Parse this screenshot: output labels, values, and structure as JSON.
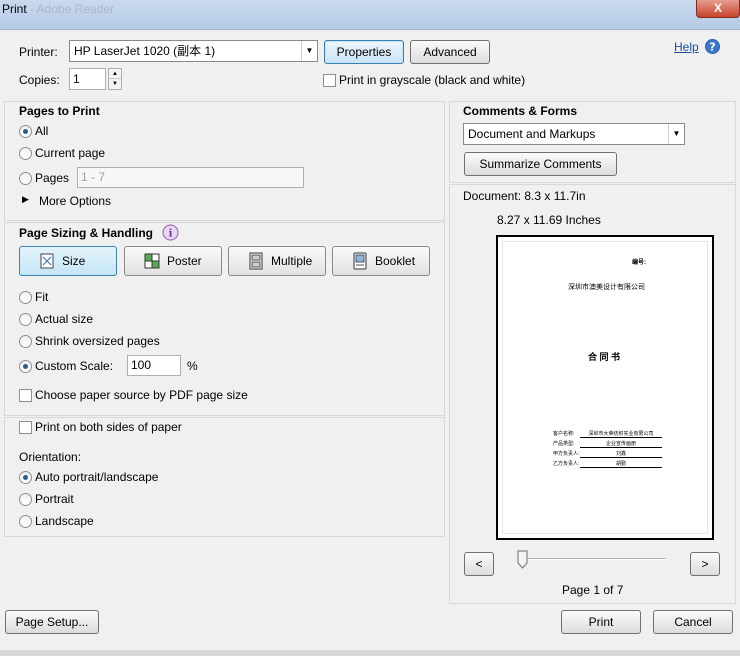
{
  "window": {
    "title": "Print",
    "ghost_title": "- Adobe Reader",
    "close_label": "X"
  },
  "printer": {
    "label": "Printer:",
    "selected": "HP LaserJet 1020 (副本 1)",
    "properties_label": "Properties",
    "advanced_label": "Advanced",
    "help_label": "Help"
  },
  "copies": {
    "label": "Copies:",
    "value": "1"
  },
  "grayscale": {
    "label": "Print in grayscale (black and white)",
    "checked": false
  },
  "pages_to_print": {
    "heading": "Pages to Print",
    "all_label": "All",
    "current_label": "Current page",
    "pages_label": "Pages",
    "pages_placeholder": "1 - 7",
    "more_options_label": "More Options",
    "selected": "All"
  },
  "sizing": {
    "heading": "Page Sizing & Handling",
    "buttons": [
      "Size",
      "Poster",
      "Multiple",
      "Booklet"
    ],
    "selected_button": "Size",
    "fit_label": "Fit",
    "actual_label": "Actual size",
    "shrink_label": "Shrink oversized pages",
    "custom_label": "Custom Scale:",
    "custom_value": "100",
    "percent": "%",
    "paper_source_label": "Choose paper source by PDF page size",
    "selected": "Custom Scale"
  },
  "duplex": {
    "label": "Print on both sides of paper",
    "checked": false
  },
  "orientation": {
    "heading": "Orientation:",
    "auto_label": "Auto portrait/landscape",
    "portrait_label": "Portrait",
    "landscape_label": "Landscape",
    "selected": "Auto portrait/landscape"
  },
  "comments": {
    "heading": "Comments & Forms",
    "selected": "Document and Markups",
    "summarize_label": "Summarize Comments"
  },
  "preview": {
    "document_size": "Document: 8.3 x 11.7in",
    "paper_size": "8.27 x 11.69 Inches",
    "doc_number": "编号:",
    "company": "深圳市澳美设计有限公司",
    "doc_title": "合 同 书",
    "fields": [
      {
        "label": "客户名称:",
        "value": "深圳市大荣纺织实业有限公司"
      },
      {
        "label": "产品类型:",
        "value": "企业宣传画册"
      },
      {
        "label": "甲方负责人:",
        "value": "刘鑫"
      },
      {
        "label": "乙方负责人:",
        "value": "胡勤"
      }
    ],
    "prev_label": "<",
    "next_label": ">",
    "page_indicator": "Page 1 of 7",
    "current_page": 1,
    "total_pages": 7
  },
  "footer": {
    "page_setup_label": "Page Setup...",
    "print_label": "Print",
    "cancel_label": "Cancel"
  }
}
